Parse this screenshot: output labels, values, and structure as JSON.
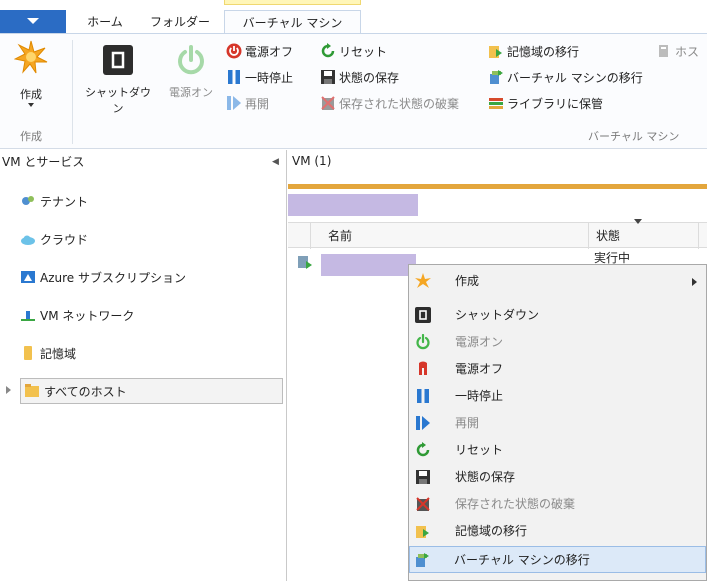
{
  "tabs": {
    "file": "",
    "home": "ホーム",
    "folder": "フォルダー",
    "vm": "バーチャル マシン"
  },
  "ribbon": {
    "create": {
      "label": "作成",
      "group": "作成"
    },
    "shutdown": "シャットダウン",
    "power_on": "電源オン",
    "power_off": "電源オフ",
    "reset": "リセット",
    "pause": "一時停止",
    "save_state": "状態の保存",
    "resume": "再開",
    "discard_state": "保存された状態の破棄",
    "migrate_storage": "記憶域の移行",
    "migrate_vm": "バーチャル マシンの移行",
    "store_library": "ライブラリに保管",
    "host": "ホス",
    "vm_group": "バーチャル マシン"
  },
  "nav": {
    "header": "VM とサービス",
    "items": [
      {
        "label": "テナント",
        "icon": "tenant-icon"
      },
      {
        "label": "クラウド",
        "icon": "cloud-icon"
      },
      {
        "label": "Azure サブスクリプション",
        "icon": "azure-icon"
      },
      {
        "label": "VM ネットワーク",
        "icon": "network-icon"
      },
      {
        "label": "記憶域",
        "icon": "storage-icon"
      },
      {
        "label": "すべてのホスト",
        "icon": "folder-icon"
      }
    ]
  },
  "content": {
    "title": "VM (1)",
    "columns": {
      "name": "名前",
      "status": "状態"
    },
    "row_status": "実行中"
  },
  "context_menu": {
    "items": [
      {
        "label": "作成",
        "icon": "star-icon",
        "disabled": false,
        "submenu": true
      },
      {
        "label": "シャットダウン",
        "icon": "shutdown-icon",
        "disabled": false
      },
      {
        "label": "電源オン",
        "icon": "power-on-icon",
        "disabled": true
      },
      {
        "label": "電源オフ",
        "icon": "power-off-icon",
        "disabled": false
      },
      {
        "label": "一時停止",
        "icon": "pause-icon",
        "disabled": false
      },
      {
        "label": "再開",
        "icon": "resume-icon",
        "disabled": true
      },
      {
        "label": "リセット",
        "icon": "reset-icon",
        "disabled": false
      },
      {
        "label": "状態の保存",
        "icon": "save-icon",
        "disabled": false
      },
      {
        "label": "保存された状態の破棄",
        "icon": "discard-icon",
        "disabled": true
      },
      {
        "label": "記憶域の移行",
        "icon": "migrate-storage-icon",
        "disabled": false
      },
      {
        "label": "バーチャル マシンの移行",
        "icon": "migrate-vm-icon",
        "disabled": false,
        "hover": true
      }
    ]
  },
  "colors": {
    "file_tab": "#2b6cc4",
    "accent_orange": "#e3a63c",
    "redacted": "#c5b9e3",
    "power_on_green": "#43b649",
    "power_off_red": "#d6362a",
    "pause_blue": "#2a78d0"
  }
}
